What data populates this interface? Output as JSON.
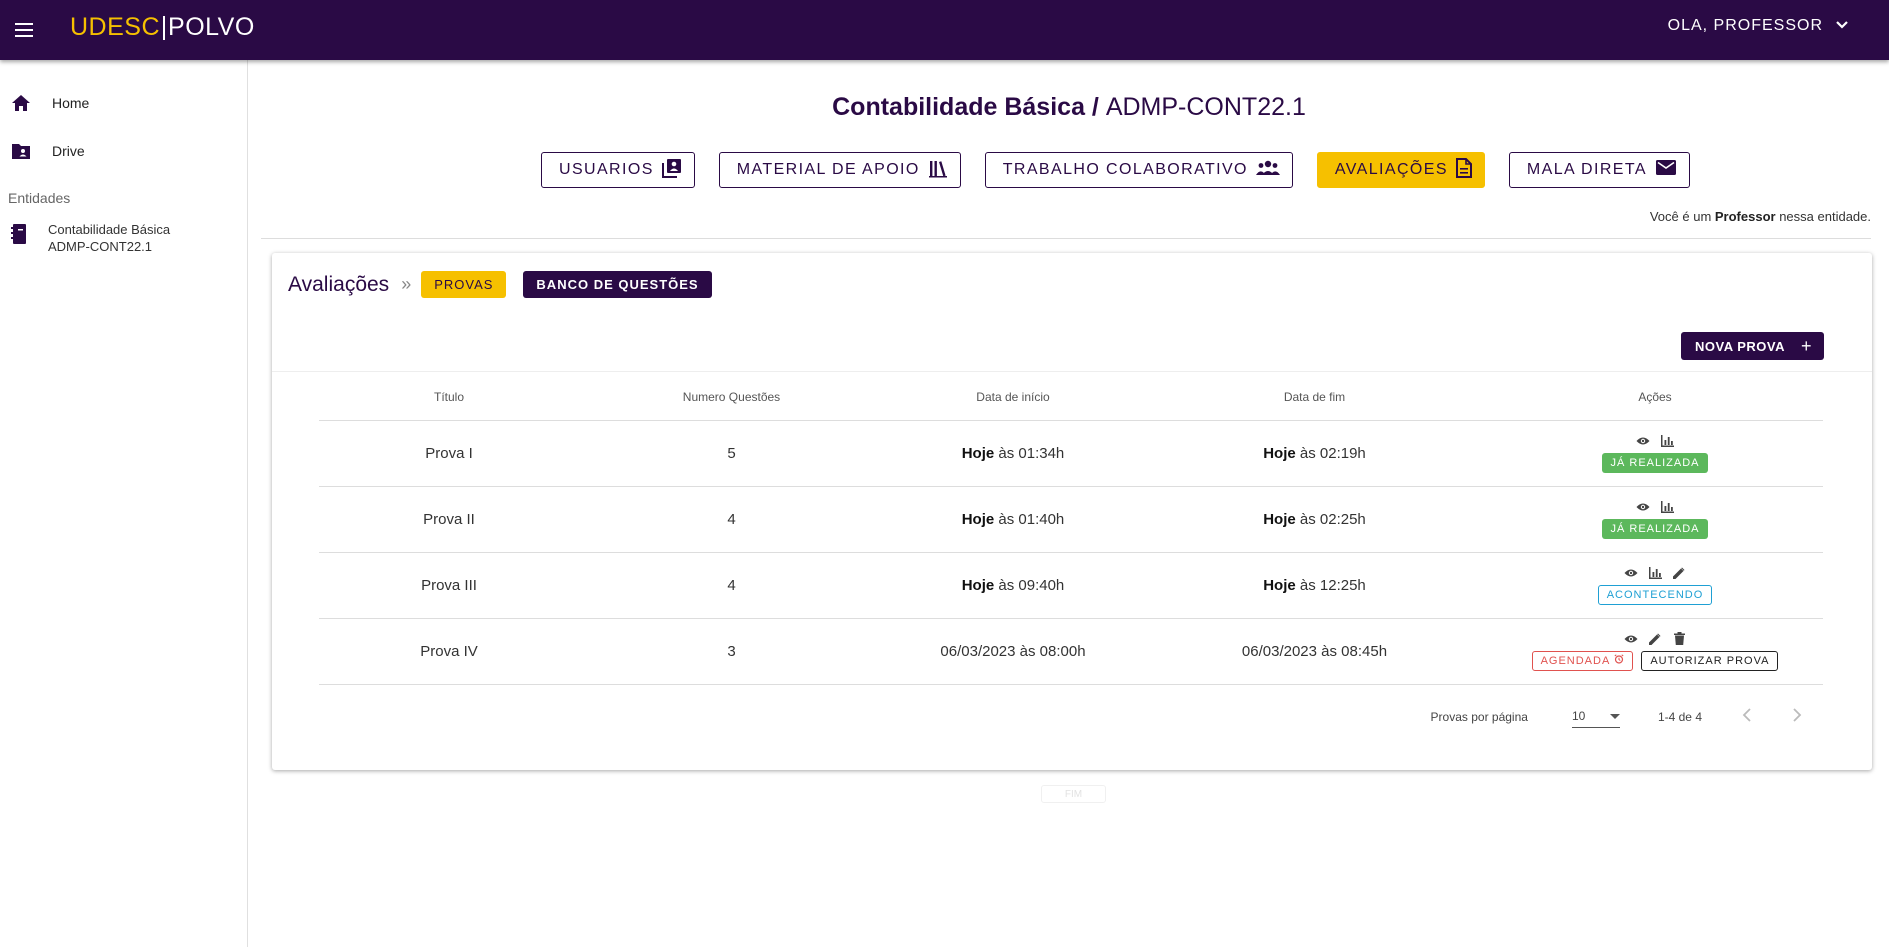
{
  "topbar": {
    "brand_left": "UDESC",
    "brand_right": "POLVO",
    "user_greeting": "OLA, PROFESSOR"
  },
  "sidebar": {
    "items": [
      {
        "label": "Home",
        "icon": "home-icon"
      },
      {
        "label": "Drive",
        "icon": "folder-shared-icon"
      }
    ],
    "section_label": "Entidades",
    "entities": [
      {
        "name": "Contabilidade Básica",
        "code": "ADMP-CONT22.1",
        "icon": "notebook-icon"
      }
    ]
  },
  "page": {
    "title_name": "Contabilidade Básica / ",
    "title_code": "ADMP-CONT22.1",
    "role_prefix": "Você é um ",
    "role_value": "Professor",
    "role_suffix": " nessa entidade."
  },
  "tabs": [
    {
      "label": "USUARIOS",
      "icon": "contacts-icon",
      "active": false
    },
    {
      "label": "MATERIAL DE APOIO",
      "icon": "library-icon",
      "active": false
    },
    {
      "label": "TRABALHO COLABORATIVO",
      "icon": "group-icon",
      "active": false
    },
    {
      "label": "AVALIAÇÕES",
      "icon": "document-icon",
      "active": true
    },
    {
      "label": "MALA DIRETA",
      "icon": "mail-icon",
      "active": false
    }
  ],
  "card": {
    "title": "Avaliações",
    "separator": "»",
    "provas_label": "PROVAS",
    "banco_label": "BANCO DE QUESTÕES",
    "nova_label": "NOVA PROVA",
    "nova_icon": "+"
  },
  "table": {
    "headers": [
      "Título",
      "Numero Questões",
      "Data de início",
      "Data de fim",
      "Ações"
    ],
    "rows": [
      {
        "titulo": "Prova I",
        "questoes": "5",
        "inicio_day": "Hoje",
        "inicio_time": " às 01:34h",
        "fim_day": "Hoje",
        "fim_time": " às 02:19h",
        "status": "JÁ REALIZADA"
      },
      {
        "titulo": "Prova II",
        "questoes": "4",
        "inicio_day": "Hoje",
        "inicio_time": " às 01:40h",
        "fim_day": "Hoje",
        "fim_time": " às 02:25h",
        "status": "JÁ REALIZADA"
      },
      {
        "titulo": "Prova III",
        "questoes": "4",
        "inicio_day": "Hoje",
        "inicio_time": " às 09:40h",
        "fim_day": "Hoje",
        "fim_time": " às 12:25h",
        "status": "ACONTECENDO"
      },
      {
        "titulo": "Prova IV",
        "questoes": "3",
        "inicio_full": "06/03/2023 às 08:00h",
        "fim_full": "06/03/2023 às 08:45h",
        "status": "AGENDADA",
        "action_label": "AUTORIZAR PROVA"
      }
    ]
  },
  "pagination": {
    "per_page_label": "Provas por página",
    "per_page_value": "10",
    "range": "1-4 de 4"
  },
  "footer_ghost": "FIM",
  "colors": {
    "primary": "#2a0a45",
    "accent": "#f6c000",
    "success": "#5cb85c",
    "info": "#1fa0d4",
    "danger": "#e0524f"
  }
}
